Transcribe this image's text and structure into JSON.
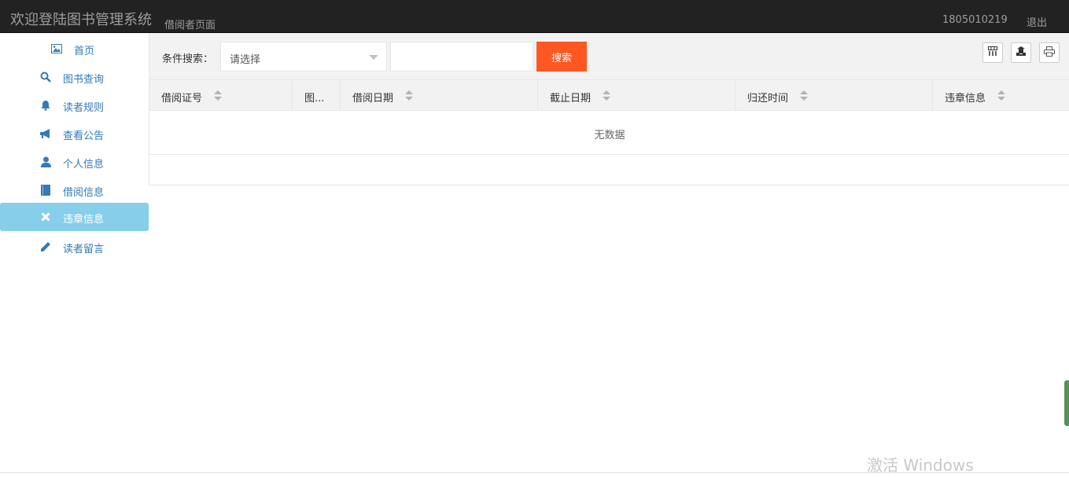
{
  "header": {
    "brand": "欢迎登陆图书管理系统",
    "subtitle": "借阅者页面",
    "user": "1805010219",
    "logout": "退出"
  },
  "sidebar": {
    "items": [
      {
        "label": "首页",
        "icon": "picture-icon",
        "active": false
      },
      {
        "label": "图书查询",
        "icon": "search-icon",
        "active": false
      },
      {
        "label": "读者规则",
        "icon": "bell-icon",
        "active": false
      },
      {
        "label": "查看公告",
        "icon": "bullhorn-icon",
        "active": false
      },
      {
        "label": "个人信息",
        "icon": "user-icon",
        "active": false
      },
      {
        "label": "借阅信息",
        "icon": "book-icon",
        "active": false
      },
      {
        "label": "违章信息",
        "icon": "remove-icon",
        "active": true
      },
      {
        "label": "读者留言",
        "icon": "pencil-icon",
        "active": false
      }
    ]
  },
  "search": {
    "label": "条件搜索：",
    "select_placeholder": "请选择",
    "input_value": "",
    "button": "搜索"
  },
  "toolbar": {
    "icons": [
      "columns-icon",
      "export-icon",
      "print-icon"
    ]
  },
  "table": {
    "columns": [
      "借阅证号",
      "图...",
      "借阅日期",
      "截止日期",
      "归还时间",
      "违章信息"
    ],
    "empty_text": "无数据"
  },
  "watermark": "激活 Windows",
  "colors": {
    "header_bg": "#222222",
    "active_nav": "#87ceeb",
    "search_button": "#ff5722",
    "nav_text": "#337ab7"
  }
}
